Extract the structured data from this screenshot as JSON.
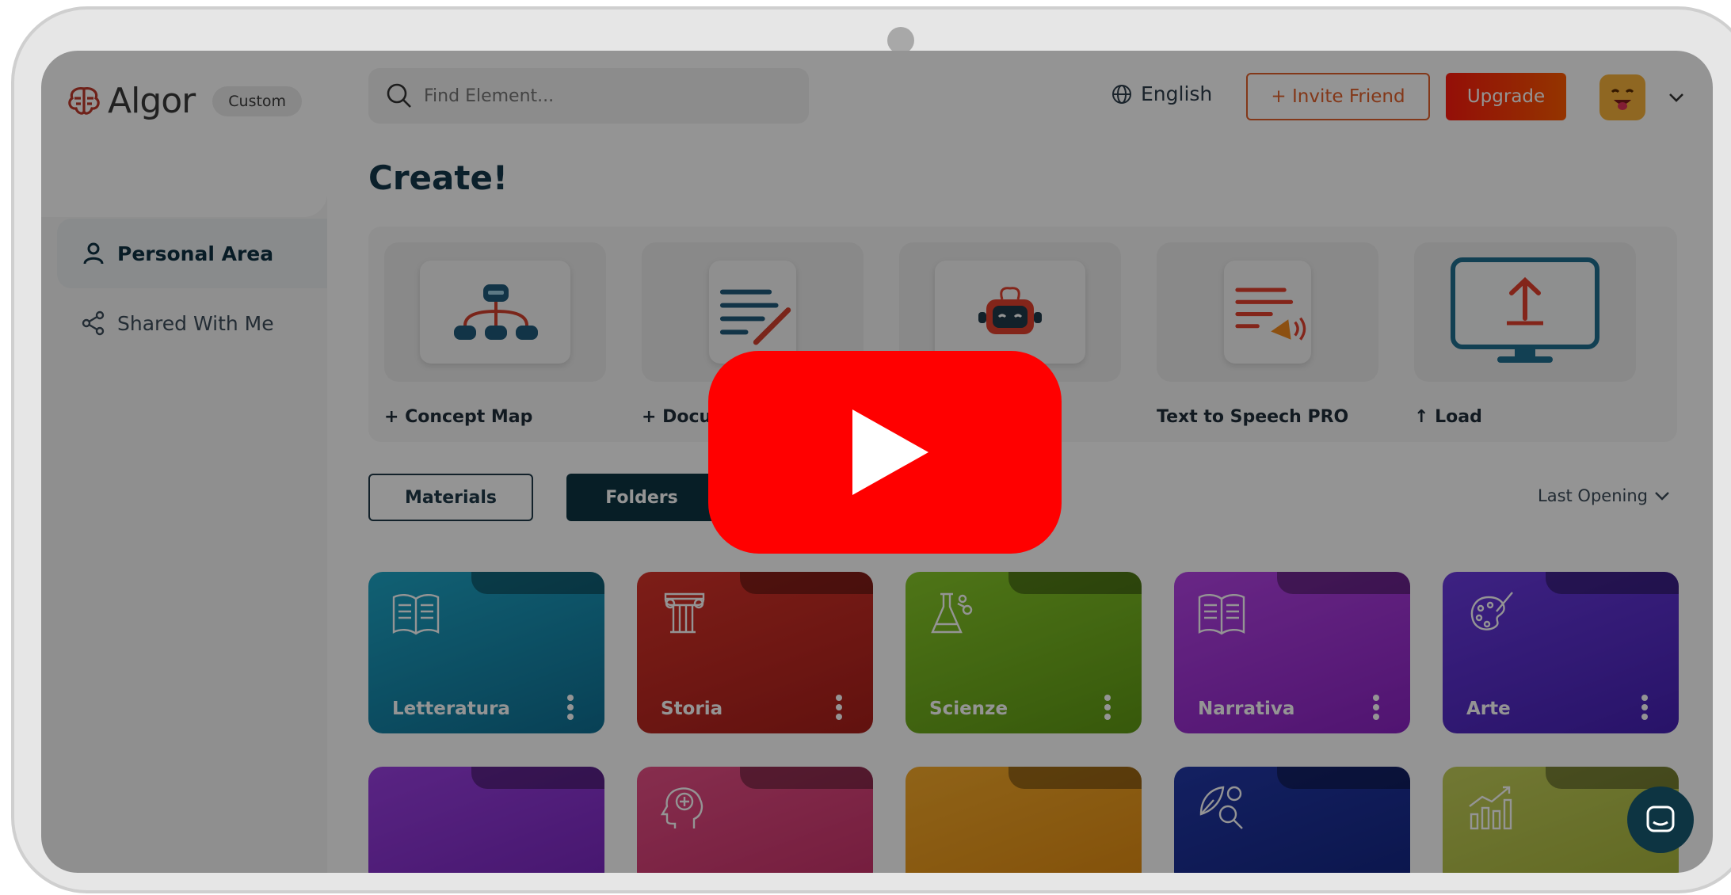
{
  "app": {
    "brand": "Algor",
    "plan_badge": "Custom"
  },
  "sidebar": {
    "items": [
      {
        "label": "Personal Area",
        "icon": "person-icon",
        "active": true
      },
      {
        "label": "Shared With Me",
        "icon": "share-icon",
        "active": false
      }
    ]
  },
  "header": {
    "search_placeholder": "Find Element...",
    "language": "English",
    "invite_label": "+ Invite Friend",
    "upgrade_label": "Upgrade",
    "avatar_icon": "smiley-avatar-icon"
  },
  "create": {
    "title": "Create!",
    "tiles": [
      {
        "label": "+ Concept Map",
        "icon": "concept-map-icon"
      },
      {
        "label": "+ Docur",
        "icon": "document-pen-icon"
      },
      {
        "label": "",
        "icon": "robot-icon"
      },
      {
        "label": "Text to Speech PRO",
        "icon": "text-to-speech-icon"
      },
      {
        "label": "↑ Load",
        "icon": "upload-monitor-icon"
      }
    ]
  },
  "tabs": {
    "materials": "Materials",
    "folders": "Folders",
    "sort_label": "Last Opening"
  },
  "folders": [
    {
      "name": "Letteratura",
      "color": "#1796b8",
      "icon": "book-icon"
    },
    {
      "name": "Storia",
      "color": "#c92c22",
      "icon": "column-icon"
    },
    {
      "name": "Scienze",
      "color": "#7bbf1e",
      "icon": "flask-icon"
    },
    {
      "name": "Narrativa",
      "color": "#a93be0",
      "icon": "book-icon"
    },
    {
      "name": "Arte",
      "color": "#5e2ed0",
      "icon": "palette-icon"
    },
    {
      "name": "",
      "color": "#8f37d8",
      "icon": ""
    },
    {
      "name": "",
      "color": "#e3457e",
      "icon": "head-brain-icon"
    },
    {
      "name": "",
      "color": "#f6a623",
      "icon": ""
    },
    {
      "name": "",
      "color": "#1c2f9c",
      "icon": "leaf-search-icon"
    },
    {
      "name": "",
      "color": "#b6c44d",
      "icon": "growth-chart-icon"
    }
  ],
  "video": {
    "play_icon": "youtube-play-icon"
  },
  "support": {
    "chat_icon": "chat-icon"
  }
}
